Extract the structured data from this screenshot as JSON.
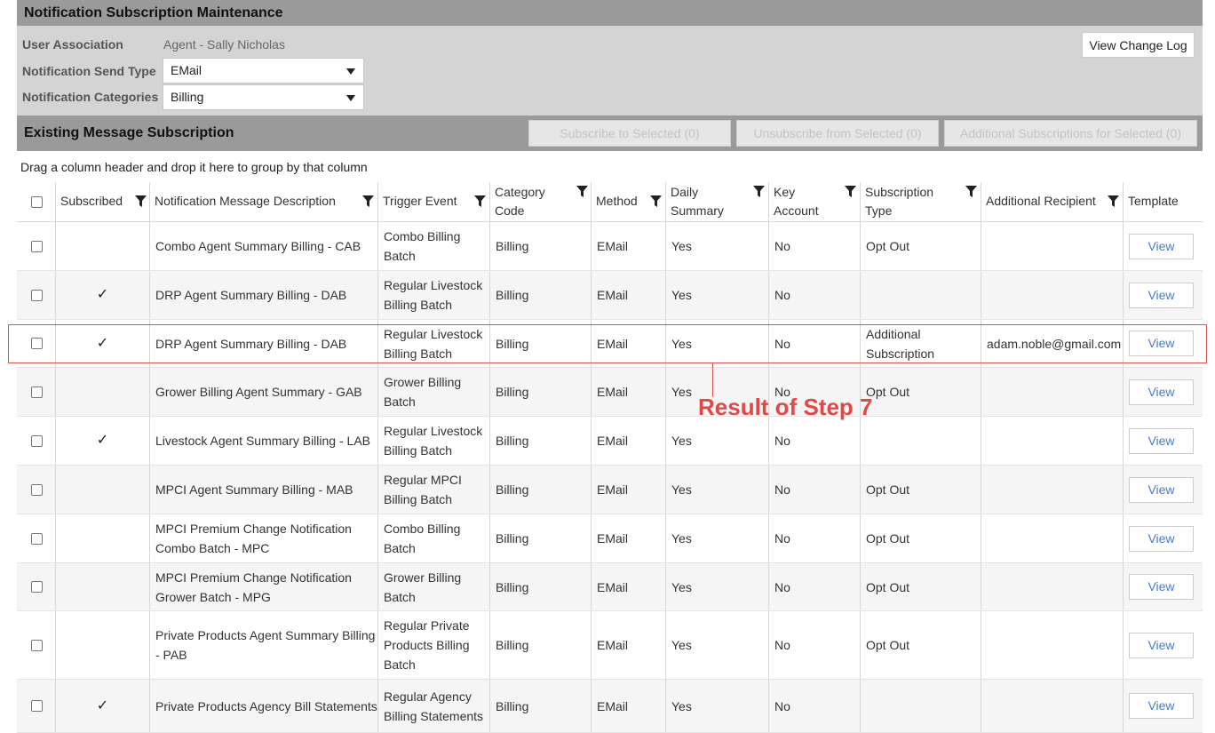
{
  "title": "Notification Subscription Maintenance",
  "form": {
    "user_association_label": "User Association",
    "user_association_value": "Agent - Sally Nicholas",
    "send_type_label": "Notification Send Type",
    "send_type_value": "EMail",
    "categories_label": "Notification Categories",
    "categories_value": "Billing",
    "view_change_log": "View Change Log"
  },
  "subscription_bar": {
    "title": "Existing Message Subscription",
    "subscribe_selected": "Subscribe to Selected (0)",
    "unsubscribe_selected": "Unsubscribe from Selected (0)",
    "additional_selected": "Additional Subscriptions for Selected (0)"
  },
  "group_hint": "Drag a column header and drop it here to group by that column",
  "columns": {
    "subscribed": "Subscribed",
    "description": "Notification Message Description",
    "trigger": "Trigger Event",
    "category_1": "Category",
    "category_2": "Code",
    "method": "Method",
    "daily_1": "Daily",
    "daily_2": "Summary",
    "key_1": "Key",
    "key_2": "Account",
    "subtype_1": "Subscription",
    "subtype_2": "Type",
    "recipient": "Additional Recipient",
    "template": "Template"
  },
  "rows": [
    {
      "subscribed": "",
      "desc_1": "Combo Agent Summary Billing - CAB",
      "desc_2": "",
      "trig_1": "Combo Billing",
      "trig_2": "Batch",
      "trig_3": "",
      "category": "Billing",
      "method": "EMail",
      "daily": "Yes",
      "key": "No",
      "sub_1": "Opt Out",
      "sub_2": "",
      "recipient": "",
      "template": "View"
    },
    {
      "subscribed": "✓",
      "desc_1": "DRP Agent Summary Billing - DAB",
      "desc_2": "",
      "trig_1": "Regular Livestock",
      "trig_2": "Billing Batch",
      "trig_3": "",
      "category": "Billing",
      "method": "EMail",
      "daily": "Yes",
      "key": "No",
      "sub_1": "",
      "sub_2": "",
      "recipient": "",
      "template": "View"
    },
    {
      "subscribed": "✓",
      "desc_1": "DRP Agent Summary Billing - DAB",
      "desc_2": "",
      "trig_1": "Regular Livestock",
      "trig_2": "Billing Batch",
      "trig_3": "",
      "category": "Billing",
      "method": "EMail",
      "daily": "Yes",
      "key": "No",
      "sub_1": "Additional",
      "sub_2": "Subscription",
      "recipient": "adam.noble@gmail.com",
      "template": "View"
    },
    {
      "subscribed": "",
      "desc_1": "Grower Billing Agent Summary - GAB",
      "desc_2": "",
      "trig_1": "Grower Billing",
      "trig_2": "Batch",
      "trig_3": "",
      "category": "Billing",
      "method": "EMail",
      "daily": "Yes",
      "key": "No",
      "sub_1": "Opt Out",
      "sub_2": "",
      "recipient": "",
      "template": "View"
    },
    {
      "subscribed": "✓",
      "desc_1": "Livestock Agent Summary Billing - LAB",
      "desc_2": "",
      "trig_1": "Regular Livestock",
      "trig_2": "Billing Batch",
      "trig_3": "",
      "category": "Billing",
      "method": "EMail",
      "daily": "Yes",
      "key": "No",
      "sub_1": "",
      "sub_2": "",
      "recipient": "",
      "template": "View"
    },
    {
      "subscribed": "",
      "desc_1": "MPCI Agent Summary Billing - MAB",
      "desc_2": "",
      "trig_1": "Regular MPCI",
      "trig_2": "Billing Batch",
      "trig_3": "",
      "category": "Billing",
      "method": "EMail",
      "daily": "Yes",
      "key": "No",
      "sub_1": "Opt Out",
      "sub_2": "",
      "recipient": "",
      "template": "View"
    },
    {
      "subscribed": "",
      "desc_1": "MPCI Premium Change Notification",
      "desc_2": "Combo Batch - MPC",
      "trig_1": "Combo Billing",
      "trig_2": "Batch",
      "trig_3": "",
      "category": "Billing",
      "method": "EMail",
      "daily": "Yes",
      "key": "No",
      "sub_1": "Opt Out",
      "sub_2": "",
      "recipient": "",
      "template": "View"
    },
    {
      "subscribed": "",
      "desc_1": "MPCI Premium Change Notification",
      "desc_2": "Grower Batch - MPG",
      "trig_1": "Grower Billing",
      "trig_2": "Batch",
      "trig_3": "",
      "category": "Billing",
      "method": "EMail",
      "daily": "Yes",
      "key": "No",
      "sub_1": "Opt Out",
      "sub_2": "",
      "recipient": "",
      "template": "View"
    },
    {
      "subscribed": "",
      "desc_1": "Private Products Agent Summary Billing",
      "desc_2": "- PAB",
      "trig_1": "Regular Private",
      "trig_2": "Products Billing",
      "trig_3": "Batch",
      "category": "Billing",
      "method": "EMail",
      "daily": "Yes",
      "key": "No",
      "sub_1": "Opt Out",
      "sub_2": "",
      "recipient": "",
      "template": "View"
    },
    {
      "subscribed": "✓",
      "desc_1": "Private Products Agency Bill Statements",
      "desc_2": "",
      "trig_1": "Regular Agency",
      "trig_2": "Billing Statements",
      "trig_3": "",
      "category": "Billing",
      "method": "EMail",
      "daily": "Yes",
      "key": "No",
      "sub_1": "",
      "sub_2": "",
      "recipient": "",
      "template": "View"
    }
  ],
  "annotation": "Result of Step 7",
  "colors": {
    "annotation": "#e04a46",
    "title_bar": "#9a9a9a",
    "form_bg": "#d4d4d4",
    "link": "#4a7bc4"
  }
}
